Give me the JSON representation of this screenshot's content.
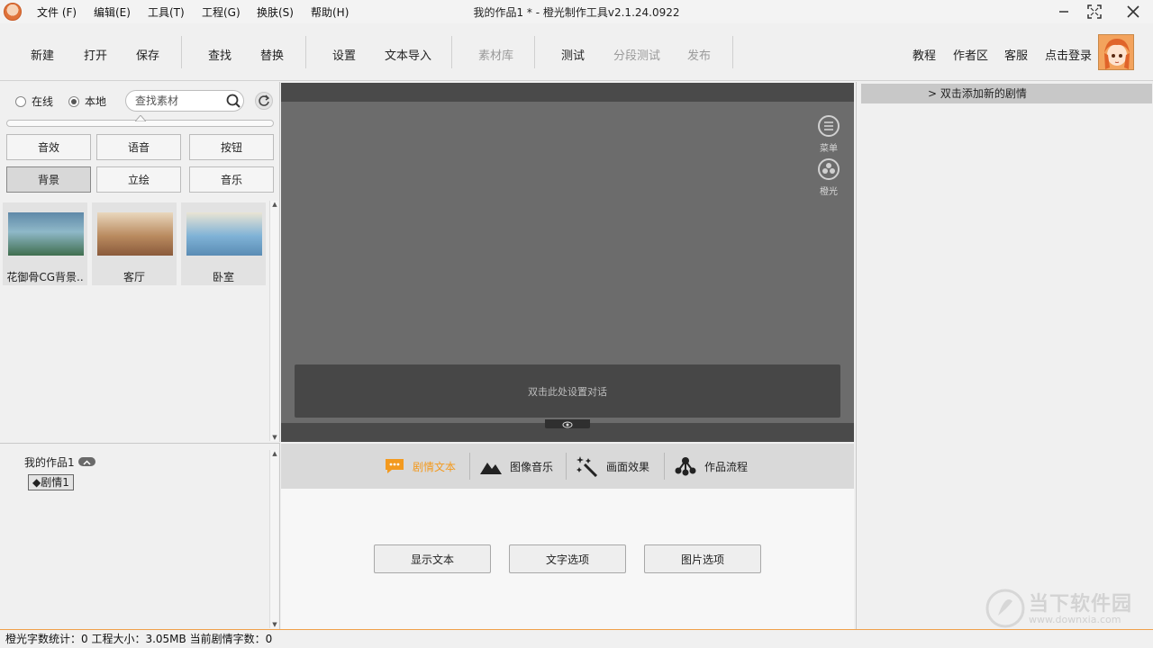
{
  "window": {
    "title": "我的作品1 * - 橙光制作工具v2.1.24.0922",
    "menu": [
      "文件 (F)",
      "编辑(E)",
      "工具(T)",
      "工程(G)",
      "换肤(S)",
      "帮助(H)"
    ]
  },
  "toolbar": {
    "left_buttons": [
      "新建",
      "打开",
      "保存",
      "查找",
      "替换",
      "设置",
      "文本导入",
      "素材库",
      "测试",
      "分段测试",
      "发布"
    ],
    "right_buttons": [
      "教程",
      "作者区",
      "客服",
      "点击登录"
    ]
  },
  "asset_panel": {
    "source_online": "在线",
    "source_local": "本地",
    "selected_source": "本地",
    "search_placeholder": "查找素材",
    "categories": [
      "音效",
      "语音",
      "按钮",
      "背景",
      "立绘",
      "音乐"
    ],
    "active_category": "背景",
    "thumbnails": [
      {
        "caption": "花御骨CG背景..",
        "colors": [
          "#5f89a8",
          "#8fb8c8",
          "#3f6e4f"
        ]
      },
      {
        "caption": "客厅",
        "colors": [
          "#b98a5f",
          "#e9d7bd",
          "#8a5a3b"
        ]
      },
      {
        "caption": "卧室",
        "colors": [
          "#7fb2d6",
          "#e9e4d4",
          "#5a8cb4"
        ]
      }
    ]
  },
  "preview": {
    "menu_label": "菜单",
    "brand_label": "橙光",
    "dialog_placeholder": "双击此处设置对话"
  },
  "storyline_panel": {
    "header": "> 双击添加新的剧情"
  },
  "project_tree": {
    "root": "我的作品1",
    "node": "◆剧情1"
  },
  "editor": {
    "tabs": [
      "剧情文本",
      "图像音乐",
      "画面效果",
      "作品流程"
    ],
    "active_tab": "剧情文本",
    "accent": "#f39a1f",
    "buttons": [
      "显示文本",
      "文字选项",
      "图片选项"
    ]
  },
  "statusbar": {
    "text": "橙光字数统计：0  工程大小：3.05MB  当前剧情字数：0"
  },
  "watermark": {
    "title": "当下软件园",
    "url": "www.downxia.com"
  }
}
